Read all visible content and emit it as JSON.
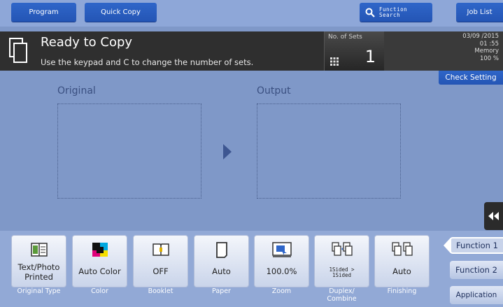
{
  "top": {
    "program": "Program",
    "quick_copy": "Quick Copy",
    "function_search_line1": "Function",
    "function_search_line2": "Search",
    "job_list": "Job List"
  },
  "status": {
    "title": "Ready to Copy",
    "message": "Use the keypad and C to change the number of sets.",
    "sets_label": "No. of Sets",
    "sets_value": "1",
    "date": "03/09 /2015",
    "time": "01 :55",
    "memory_label": "Memory",
    "memory_value": "100 %"
  },
  "check_setting": "Check Setting",
  "preview": {
    "original_label": "Original",
    "output_label": "Output"
  },
  "functions": [
    {
      "value_line1": "Text/Photo",
      "value_line2": "Printed",
      "caption": "Original Type"
    },
    {
      "value": "Auto Color",
      "caption": "Color"
    },
    {
      "value": "OFF",
      "caption": "Booklet"
    },
    {
      "value": "Auto",
      "caption": "Paper"
    },
    {
      "value": "100.0%",
      "caption": "Zoom"
    },
    {
      "value_line1": "1Sided >",
      "value_line2": "1Sided",
      "caption_line1": "Duplex/",
      "caption_line2": "Combine"
    },
    {
      "value": "Auto",
      "caption": "Finishing"
    }
  ],
  "side_tabs": {
    "function1": "Function 1",
    "function2": "Function 2",
    "application": "Application"
  },
  "colors": {
    "accent_blue": "#2f66c9",
    "background": "#7f98c8",
    "status_bar": "#2f2f2f"
  }
}
